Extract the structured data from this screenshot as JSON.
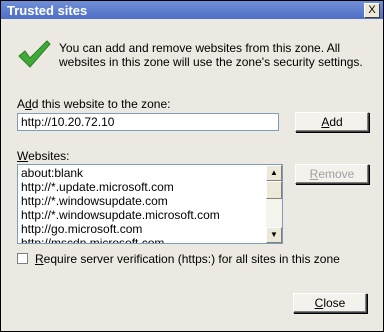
{
  "window": {
    "title": "Trusted sites",
    "close_label": "X"
  },
  "info": {
    "message": "You can add and remove websites from this zone. All websites in this zone will use the zone's security settings."
  },
  "add_site": {
    "label_prefix": "A",
    "label_underlined": "d",
    "label_rest": "d this website to the zone:",
    "input_value": "http://10.20.72.10",
    "add_button_underlined": "A",
    "add_button_rest": "dd"
  },
  "websites": {
    "label_underlined": "W",
    "label_rest": "ebsites:",
    "items": [
      "about:blank",
      "http://*.update.microsoft.com",
      "http://*.windowsupdate.com",
      "http://*.windowsupdate.microsoft.com",
      "http://go.microsoft.com",
      "http://mscdn.microsoft.com"
    ],
    "remove_button_underlined": "R",
    "remove_button_rest": "emove"
  },
  "verification": {
    "label_underlined": "R",
    "label_rest": "equire server verification (https:) for all sites in this zone",
    "checked": false
  },
  "footer": {
    "close_button_underlined": "C",
    "close_button_rest": "lose"
  },
  "colors": {
    "checkmark": "#3faa3a",
    "titlebar": "#5a7acb"
  }
}
